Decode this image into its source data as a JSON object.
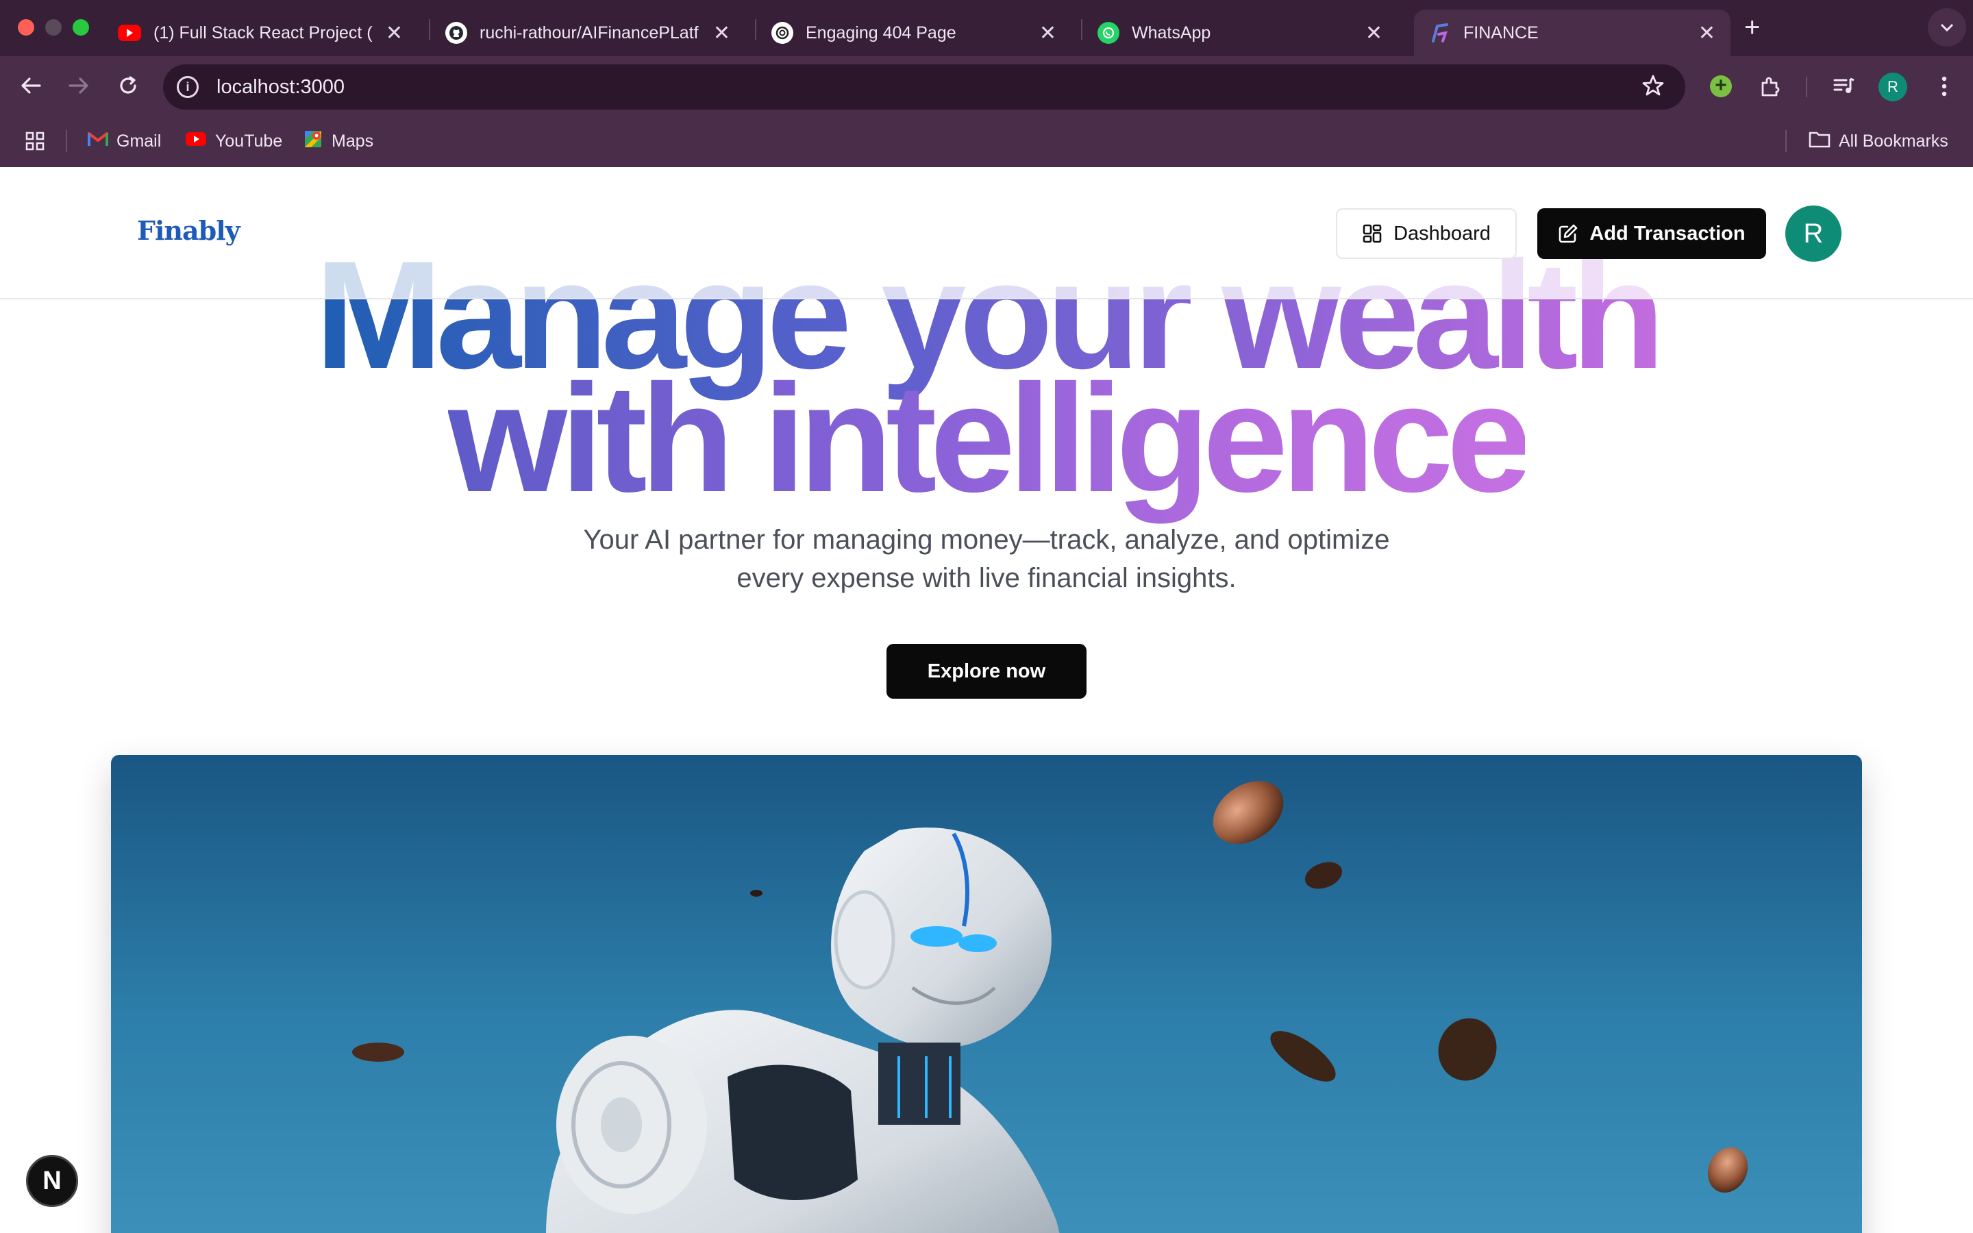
{
  "browser": {
    "tabs": [
      {
        "title": "(1) Full Stack React Project (",
        "icon": "youtube-icon",
        "color": "#ff0000"
      },
      {
        "title": "ruchi-rathour/AIFinancePLatf",
        "icon": "github-icon",
        "color": "#ffffff"
      },
      {
        "title": "Engaging 404 Page",
        "icon": "openai-icon",
        "color": "#ffffff"
      },
      {
        "title": "WhatsApp",
        "icon": "whatsapp-icon",
        "color": "#25d366"
      },
      {
        "title": "FINANCE",
        "icon": "finance-logo-icon",
        "color": "#5a7ee0",
        "active": true
      }
    ],
    "url": "localhost:3000",
    "profile_initial": "R",
    "bookmarks": [
      {
        "label": "Gmail",
        "icon": "gmail-icon"
      },
      {
        "label": "YouTube",
        "icon": "youtube-icon"
      },
      {
        "label": "Maps",
        "icon": "maps-icon"
      }
    ],
    "all_bookmarks_label": "All Bookmarks"
  },
  "site": {
    "logo": "Finably",
    "dashboard_label": "Dashboard",
    "add_transaction_label": "Add Transaction",
    "user_initial": "R"
  },
  "hero": {
    "line1": "Manage your wealth",
    "line2": "with intelligence",
    "subtitle_line1": "Your AI partner for managing money—track, analyze, and optimize",
    "subtitle_line2": "every expense with live financial insights.",
    "cta": "Explore now"
  },
  "dev_badge": "N",
  "colors": {
    "tabstrip": "#361f37",
    "toolbar": "#4a2d49",
    "accent_dark": "#0a0a0a",
    "avatar": "#0f8c76",
    "logo": "#1e5bb8"
  }
}
